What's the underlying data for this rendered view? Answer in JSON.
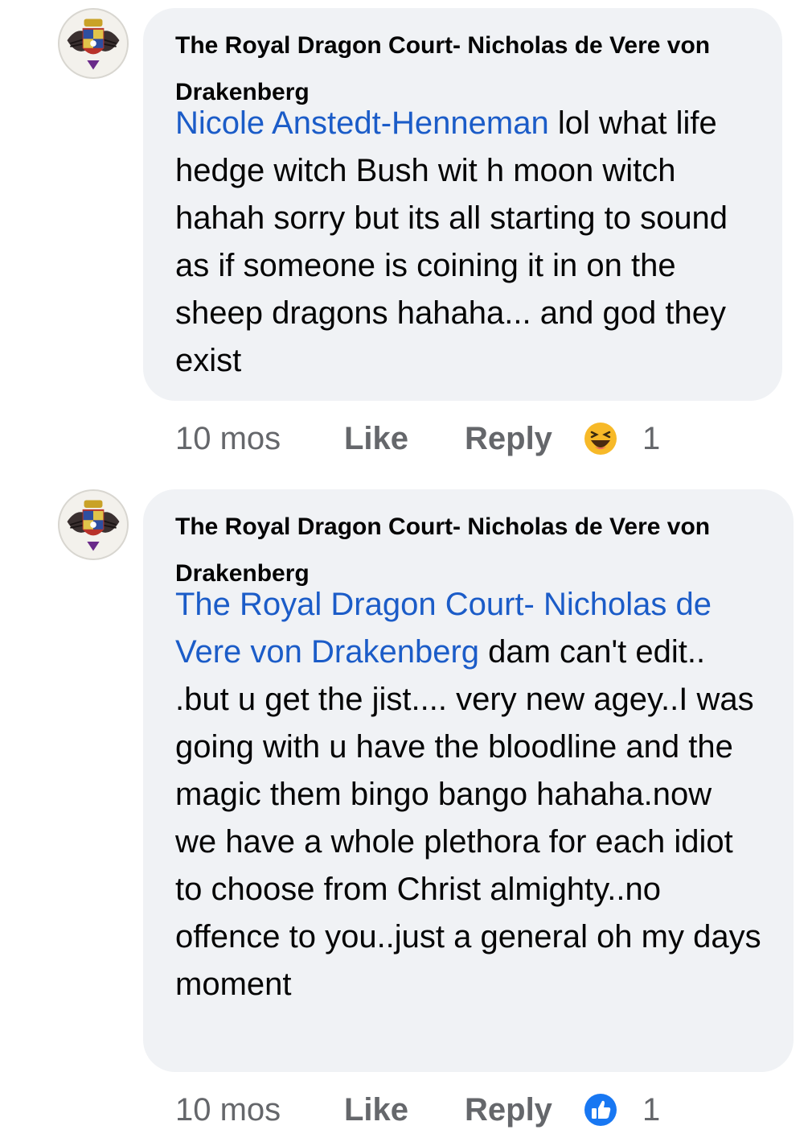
{
  "comments": [
    {
      "author": "The Royal Dragon Court- Nicholas de Vere von Drakenberg",
      "mention": "Nicole Anstedt-Henneman",
      "text": " lol what life hedge witch Bush wit h moon witch hahah sorry but its all starting to sound as if someone is coining it in on the sheep dragons hahaha... and god they exist",
      "time": "10 mos",
      "like_label": "Like",
      "reply_label": "Reply",
      "reaction_icon": "haha-icon",
      "reaction_count": "1"
    },
    {
      "author": "The Royal Dragon Court- Nicholas de Vere von Drakenberg",
      "mention": "The Royal Dragon Court- Nicholas de Vere von Drakenberg",
      "text": " dam can't edit.. .but u get the jist.... very new agey..I was going with u have the bloodline and the magic them bingo bango hahaha.now we have a whole plethora for each idiot to choose from Christ almighty..no offence to you..just a general oh my days moment",
      "time": "10 mos",
      "like_label": "Like",
      "reply_label": "Reply",
      "reaction_icon": "like-icon",
      "reaction_count": "1"
    }
  ],
  "colors": {
    "bubble": "#f0f2f5",
    "mention": "#1b5cc8",
    "meta": "#65676b",
    "like_blue": "#1877f2",
    "haha_yellow": "#f7b928"
  }
}
